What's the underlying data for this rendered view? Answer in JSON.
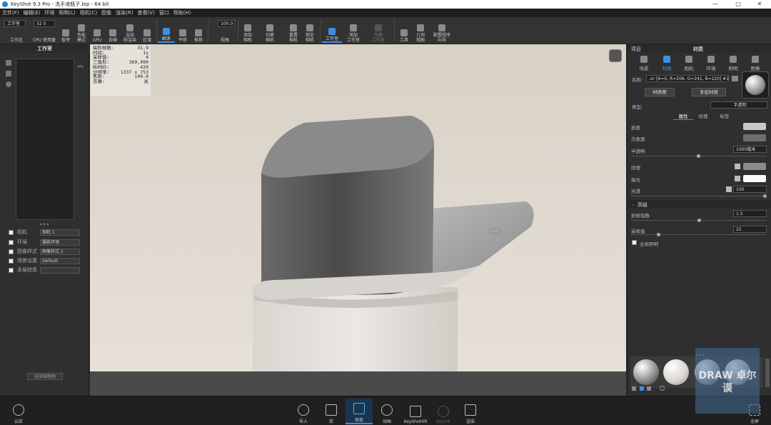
{
  "window": {
    "title": "KeyShot 9.3 Pro  -  洗手液瓶子.bip  -  64 bit",
    "controls": [
      "—",
      "□",
      "✕"
    ]
  },
  "menu": [
    "文件(F)",
    "编辑(E)",
    "环境",
    "照明(L)",
    "相机(C)",
    "图像",
    "渲染(R)",
    "查看(V)",
    "窗口",
    "帮助(H)"
  ],
  "toolbar": {
    "workspace_select": "工作室",
    "cpu_value": "32 5",
    "fov_value": "100.0",
    "buttons": {
      "workspace": "工作区",
      "cpu": "CPU 使用量",
      "pause": "暂停",
      "perf": "性能\n模式",
      "gpu": "GPU",
      "denoise": "去噪",
      "region_render": "渲染\n和渲染",
      "region": "区域",
      "tumble": "翻滚",
      "pan": "平移",
      "dolly": "推移",
      "view_angle": "视角",
      "add_camera": "添加\n相机",
      "switch_camera": "切换\n相机",
      "reset_camera": "重置\n相机",
      "lock_camera": "锁定\n相机",
      "studio": "工作室",
      "add_studio": "添加\n工作室",
      "switch_studio": "切换\n工作室",
      "tools": "工具",
      "geometry_view": "几何\n视图",
      "config": "配置程序\n向导"
    }
  },
  "left_panel": {
    "title": "工作室",
    "rows": [
      {
        "label": "相机",
        "value": "相机 1"
      },
      {
        "label": "环境",
        "value": "摄影环境"
      },
      {
        "label": "图像样式",
        "value": "图像样式 1"
      },
      {
        "label": "场景设置",
        "value": "Default"
      },
      {
        "label": "多层材质",
        "value": ""
      }
    ],
    "render_button": "渲染缩略图"
  },
  "hud": [
    {
      "k": "每秒帧数:",
      "v": "31.9"
    },
    {
      "k": "时间:",
      "v": "1s"
    },
    {
      "k": "采样值:",
      "v": "4"
    },
    {
      "k": "三角形:",
      "v": "369,990"
    },
    {
      "k": "NURBS:",
      "v": "420"
    },
    {
      "k": "分辨率:",
      "v": "1337 x 753"
    },
    {
      "k": "焦距:",
      "v": "100.0"
    },
    {
      "k": "去噪:",
      "v": "关"
    }
  ],
  "right_panel": {
    "header_left": "项目",
    "header_title": "材质",
    "tabs": [
      "场景",
      "材质",
      "相机",
      "环境",
      "照明",
      "图像"
    ],
    "name_label": "名称:",
    "name_value": ".or [A=0, R=206, G=241, B=220] #1",
    "btn_material_graph": "材质图",
    "btn_multi_layer": "多层材质",
    "type_label": "类型:",
    "type_value": "半透明",
    "subtabs": [
      "属性",
      "纹理",
      "标签"
    ],
    "props": {
      "surface": "表面",
      "subsurface": "次表面",
      "translucency": "半透明",
      "translucency_value": "1000毫米",
      "texture": "纹理",
      "specular": "高光",
      "roughness": "光滑",
      "roughness_value": "100",
      "advanced": "高级",
      "ior": "折射指数",
      "ior_value": "1.5",
      "samples": "采样值",
      "samples_value": "25",
      "global_illum": "全局照明"
    }
  },
  "bottom_bar": {
    "cloud": "云库",
    "import": "导入",
    "library": "库",
    "project": "项目",
    "animation": "动画",
    "keyshotxr": "KeyShotXR",
    "keyvr": "KeyVR",
    "render": "渲染",
    "fullscreen": "全屏"
  },
  "watermark": "DRAW 卓尔谟",
  "colors": {
    "accent": "#3d8fe0",
    "viewport_bg": "#ded7cd"
  }
}
